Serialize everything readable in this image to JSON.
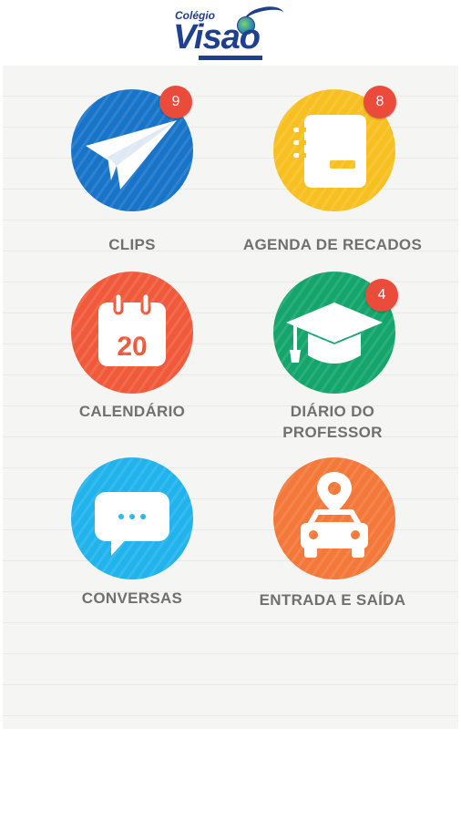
{
  "logo": {
    "small": "Colégio",
    "big": "Visao"
  },
  "colors": {
    "clips": "#1874c8",
    "agenda": "#f7c020",
    "calendario": "#f05a3a",
    "diario": "#14a56b",
    "conversas": "#20b3ec",
    "entrada": "#f37839",
    "badge": "#ea4b3b"
  },
  "tiles": [
    {
      "label": "CLIPS",
      "icon": "paper-plane-icon",
      "badge": "9"
    },
    {
      "label": "AGENDA DE RECADOS",
      "icon": "notebook-icon",
      "badge": "8"
    },
    {
      "label": "CALENDÁRIO",
      "icon": "calendar-icon",
      "day": "20"
    },
    {
      "label_line1": "DIÁRIO DO",
      "label_line2": "PROFESSOR",
      "icon": "graduation-cap-icon",
      "badge": "4"
    },
    {
      "label": "CONVERSAS",
      "icon": "chat-bubble-icon"
    },
    {
      "label": "ENTRADA E SAÍDA",
      "icon": "car-location-icon"
    }
  ]
}
